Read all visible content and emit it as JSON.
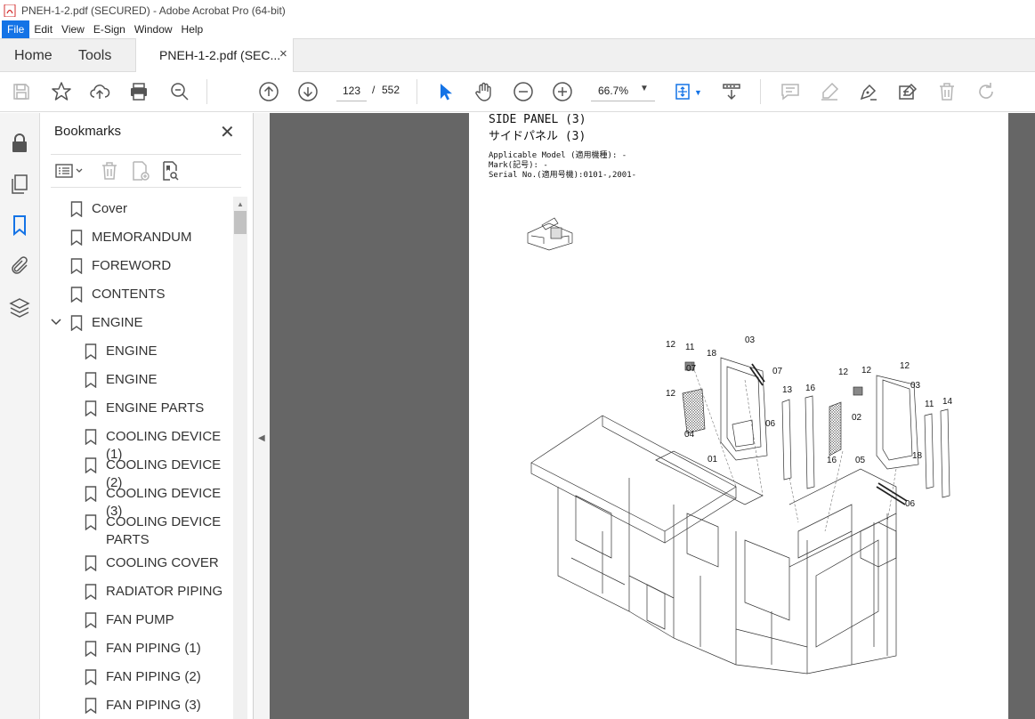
{
  "window": {
    "title": "PNEH-1-2.pdf (SECURED) - Adobe Acrobat Pro (64-bit)"
  },
  "menu": [
    "File",
    "Edit",
    "View",
    "E-Sign",
    "Window",
    "Help"
  ],
  "tabs": {
    "home": "Home",
    "tools": "Tools",
    "doc": "PNEH-1-2.pdf (SEC...",
    "close": "×"
  },
  "toolbar": {
    "page_current": "123",
    "page_sep": "/",
    "page_total": "552",
    "zoom": "66.7%",
    "zoom_caret": "▼"
  },
  "bookmarks": {
    "title": "Bookmarks",
    "close": "✕",
    "items": [
      {
        "label": "Cover"
      },
      {
        "label": "MEMORANDUM"
      },
      {
        "label": "FOREWORD"
      },
      {
        "label": "CONTENTS"
      },
      {
        "label": "ENGINE"
      },
      {
        "label": "ENGINE"
      },
      {
        "label": "ENGINE"
      },
      {
        "label": "ENGINE PARTS"
      },
      {
        "label": "COOLING DEVICE (1)"
      },
      {
        "label": "COOLING DEVICE (2)"
      },
      {
        "label": "COOLING DEVICE (3)"
      },
      {
        "label": "COOLING DEVICE"
      },
      {
        "label": "PARTS"
      },
      {
        "label": "COOLING COVER"
      },
      {
        "label": "RADIATOR PIPING"
      },
      {
        "label": "FAN PUMP"
      },
      {
        "label": "FAN PIPING (1)"
      },
      {
        "label": "FAN PIPING (2)"
      },
      {
        "label": "FAN PIPING (3)"
      }
    ]
  },
  "document": {
    "title_en": "SIDE PANEL (3)",
    "title_jp": "サイドパネル (3)",
    "meta": [
      "Applicable Model (適用機種): -",
      "Mark(記号): -",
      "Serial No.(適用号機):0101-,2001-"
    ],
    "callouts": [
      "12",
      "11",
      "03",
      "18",
      "07",
      "12",
      "12",
      "04",
      "13",
      "16",
      "06",
      "01",
      "12",
      "12",
      "03",
      "02",
      "11",
      "14",
      "16",
      "05",
      "18",
      "06",
      "07"
    ]
  }
}
